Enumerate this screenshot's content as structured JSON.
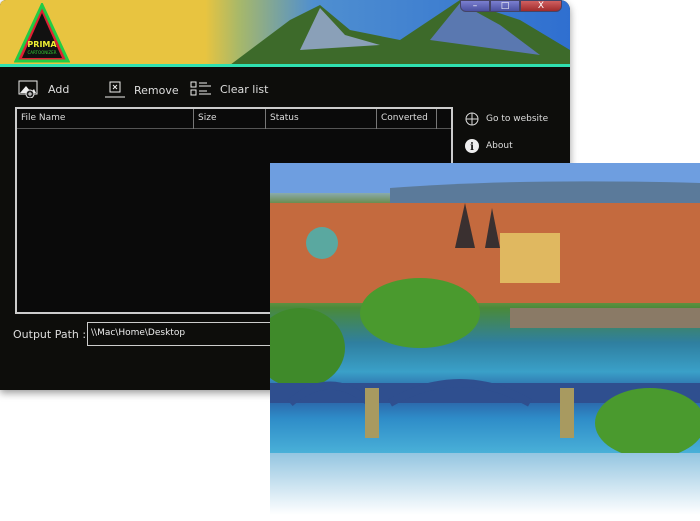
{
  "app": {
    "logo_line1": "PRIMA",
    "logo_line2": "CARTOONIZER"
  },
  "window_controls": {
    "minimize": "–",
    "maximize": "□",
    "close": "X"
  },
  "toolbar": {
    "add": "Add",
    "remove": "Remove",
    "clear": "Clear list"
  },
  "table": {
    "columns": [
      "File Name",
      "Size",
      "Status",
      "Converted"
    ]
  },
  "side": {
    "website": "Go to website",
    "about": "About"
  },
  "output": {
    "label": "Output Path :",
    "value": "\\\\Mac\\Home\\Desktop"
  }
}
